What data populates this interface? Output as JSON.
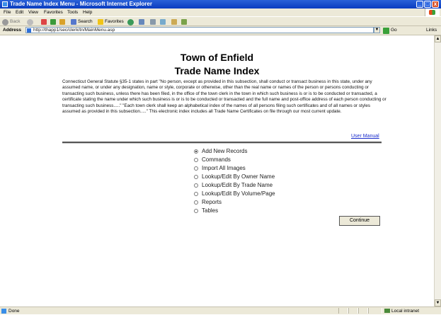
{
  "window": {
    "title": "Trade Name Index Menu - Microsoft Internet Explorer",
    "controls": {
      "minimize": "_",
      "maximize": "□",
      "close": "x"
    }
  },
  "menubar": {
    "items": [
      "File",
      "Edit",
      "View",
      "Favorites",
      "Tools",
      "Help"
    ]
  },
  "toolbar": {
    "back_label": "Back",
    "search_label": "Search",
    "favorites_label": "Favorites"
  },
  "addressbar": {
    "label": "Address",
    "url": "http://thapp1/sec/clerk/tn/MainMenu.asp",
    "go_label": "Go",
    "links_label": "Links"
  },
  "page": {
    "title": "Town of Enfield",
    "subtitle": "Trade Name Index",
    "statute_text": "Connecticut General Statute §35-1 states in part \"No person, except as provided in this subsection, shall conduct or transact business in this state, under any assumed name, or under any designation, name or style, corporate or otherwise, other than the real name or names of the person or persons conducting or transacting such business, unless there has been filed, in the office of the town clerk in the town in which such business is or is to be conducted or transacted, a certificate stating the name under which such business is or is to be conducted or transacted and the full name and post-office address of each person conducting or transacting such business.....\" \"Each town clerk shall keep an alphabetical index of the names of all persons filing such certificates and of all names or styles assumed as provided in this subsection.....\" This electronic index includes all Trade Name Certificates on file through our most current update.",
    "user_manual_link": "User Manual",
    "options": [
      {
        "label": "Add New Records",
        "selected": true
      },
      {
        "label": "Commands",
        "selected": false
      },
      {
        "label": "Import All Images",
        "selected": false
      },
      {
        "label": "Lookup/Edit By Owner Name",
        "selected": false
      },
      {
        "label": "Lookup/Edit By Trade Name",
        "selected": false
      },
      {
        "label": "Lookup/Edit By Volume/Page",
        "selected": false
      },
      {
        "label": "Reports",
        "selected": false
      },
      {
        "label": "Tables",
        "selected": false
      }
    ],
    "continue_label": "Continue"
  },
  "statusbar": {
    "status": "Done",
    "zone": "Local intranet"
  },
  "colors": {
    "titlebar": "#0a3cc0",
    "chrome": "#ece9d8",
    "link": "#1a2ccc"
  }
}
